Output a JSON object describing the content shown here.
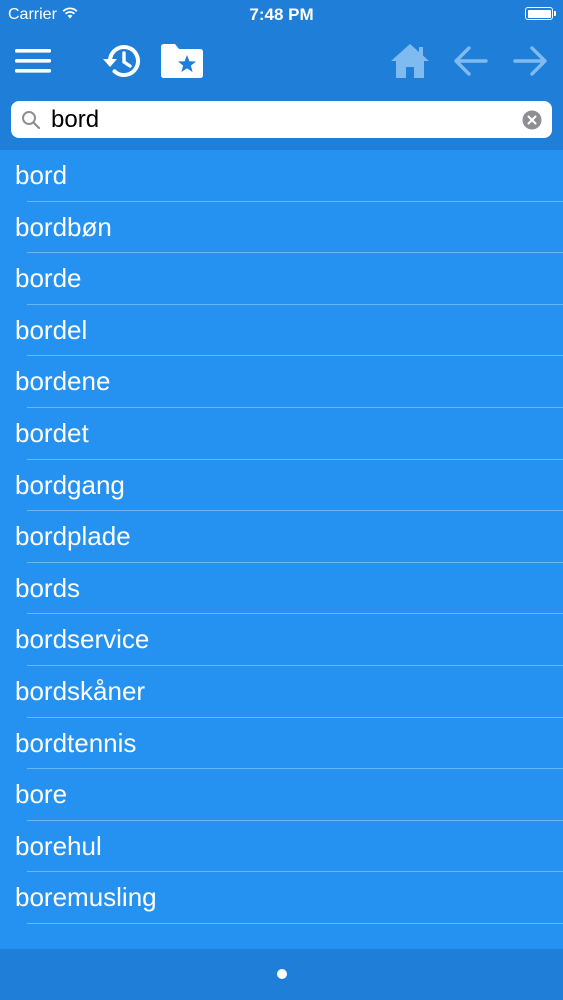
{
  "status": {
    "carrier": "Carrier",
    "time": "7:48 PM"
  },
  "toolbar": {
    "icons": [
      "menu-icon",
      "history-icon",
      "favorites-folder-icon",
      "home-icon",
      "back-arrow-icon",
      "forward-arrow-icon"
    ],
    "colors": {
      "active": "#ffffff",
      "dimmed": "#7fbaf0"
    }
  },
  "search": {
    "value": "bord",
    "placeholder": ""
  },
  "results": [
    {
      "label": "bord"
    },
    {
      "label": "bordbøn"
    },
    {
      "label": "borde"
    },
    {
      "label": "bordel"
    },
    {
      "label": "bordene"
    },
    {
      "label": "bordet"
    },
    {
      "label": "bordgang"
    },
    {
      "label": "bordplade"
    },
    {
      "label": "bords"
    },
    {
      "label": "bordservice"
    },
    {
      "label": "bordskåner"
    },
    {
      "label": "bordtennis"
    },
    {
      "label": "bore"
    },
    {
      "label": "borehul"
    },
    {
      "label": "boremusling"
    }
  ],
  "pager": {
    "current": 1,
    "total": 1
  },
  "colors": {
    "header_bg": "#1f7fd8",
    "list_bg": "#2592f2",
    "separator": "#6ab7f8",
    "text": "#ffffff"
  }
}
